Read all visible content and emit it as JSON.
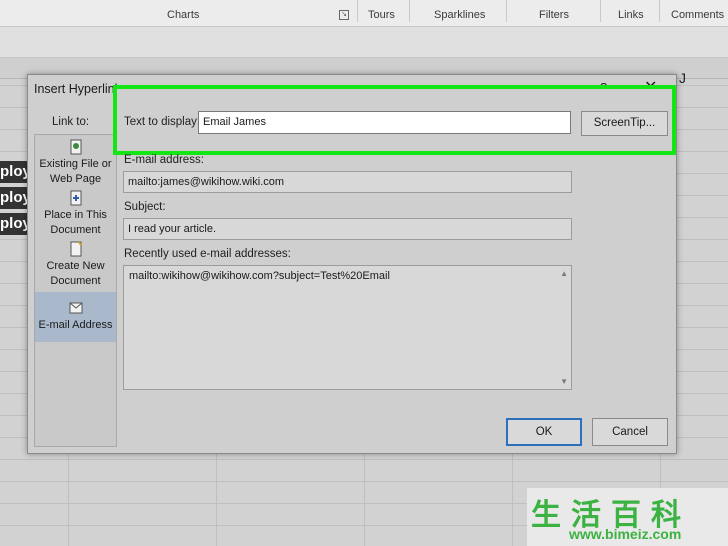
{
  "ribbon": {
    "groups": [
      "Charts",
      "Tours",
      "Sparklines",
      "Filters",
      "Links",
      "Comments"
    ]
  },
  "sheet": {
    "column_letter": "J",
    "cells": [
      "ploy",
      "ploy",
      "ploy"
    ]
  },
  "dialog": {
    "title": "Insert Hyperlink",
    "help": "?",
    "close": "✕",
    "link_to_label": "Link to:",
    "link_to_items": [
      {
        "label": "Existing File or Web Page",
        "icon": "web-page-icon"
      },
      {
        "label": "Place in This Document",
        "icon": "document-place-icon"
      },
      {
        "label": "Create New Document",
        "icon": "new-document-icon"
      },
      {
        "label": "E-mail Address",
        "icon": "email-icon",
        "selected": true
      }
    ],
    "text_to_display_label": "Text to display:",
    "text_to_display_value": "Email James",
    "screentip_button": "ScreenTip...",
    "email_address_label": "E-mail address:",
    "email_address_value": "mailto:james@wikihow.wiki.com",
    "subject_label": "Subject:",
    "subject_value": "I read your article.",
    "recent_label": "Recently used e-mail addresses:",
    "recent_items": [
      "mailto:wikihow@wikihow.com?subject=Test%20Email"
    ],
    "ok_button": "OK",
    "cancel_button": "Cancel"
  },
  "watermark": {
    "chinese": "生活百科",
    "url": "www.bimeiz.com"
  },
  "colors": {
    "highlight": "#14e614",
    "selected_item": "#a9b9cb",
    "ok_border": "#2d6fbf"
  }
}
